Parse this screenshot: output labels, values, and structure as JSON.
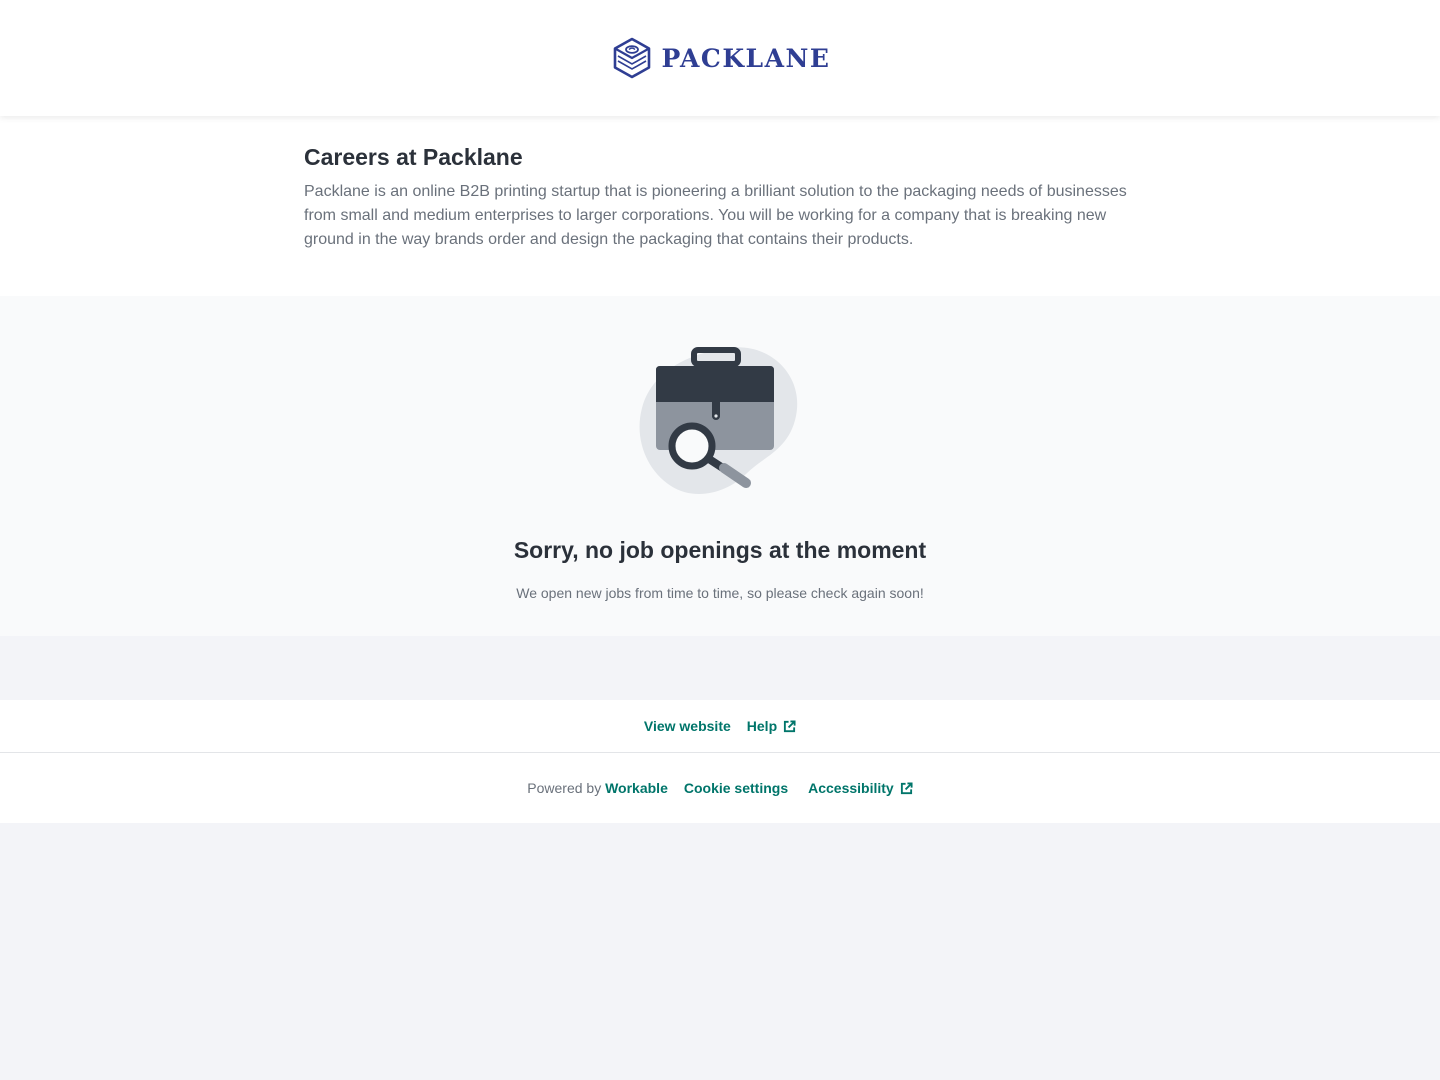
{
  "header": {
    "logo_text": "PACKLANE",
    "brand_color": "#2f3e93"
  },
  "intro": {
    "title": "Careers at Packlane",
    "description": "Packlane is an online B2B printing startup that is pioneering a brilliant solution to the packaging needs of businesses from small and medium enterprises to larger corporations. You will be working for a company that is breaking new ground in the way brands order and design the packaging that contains their products."
  },
  "empty_state": {
    "illustration": "briefcase-search-icon",
    "title": "Sorry, no job openings at the moment",
    "subtitle": "We open new jobs from time to time, so please check again soon!"
  },
  "footer": {
    "view_website": "View website",
    "help": "Help",
    "powered_by": "Powered by",
    "workable": "Workable",
    "cookie_settings": "Cookie settings",
    "accessibility": "Accessibility",
    "external_icon": "external-link-icon",
    "link_color": "#00756a"
  }
}
